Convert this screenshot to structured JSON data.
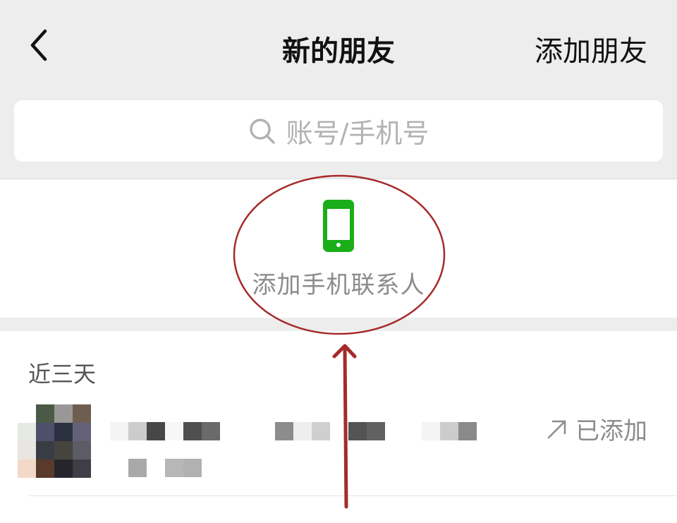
{
  "nav": {
    "title": "新的朋友",
    "add_friend_label": "添加朋友",
    "back_icon": "chevron-left-icon"
  },
  "search": {
    "placeholder": "账号/手机号",
    "icon": "search-icon"
  },
  "phone_contacts": {
    "label": "添加手机联系人",
    "icon": "mobile-phone-icon",
    "icon_color": "#1aad19"
  },
  "recent": {
    "header": "近三天",
    "items": [
      {
        "status_label": "已添加",
        "status_icon": "arrow-up-right-icon"
      }
    ]
  },
  "colors": {
    "background": "#ededed",
    "surface": "#ffffff",
    "annotation": "#a52a2a"
  }
}
